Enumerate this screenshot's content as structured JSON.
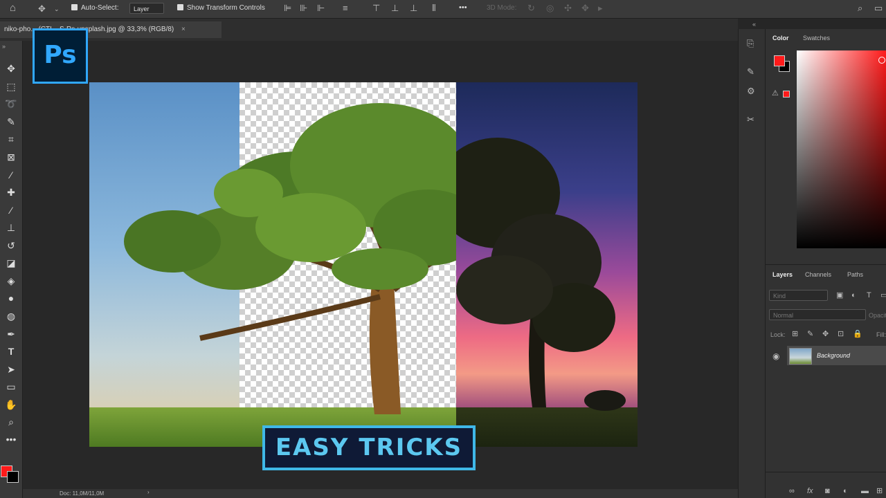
{
  "options_bar": {
    "auto_select_label": "Auto-Select:",
    "auto_select_value": "Layer",
    "show_transform_label": "Show Transform Controls",
    "mode_3d_label": "3D Mode:",
    "more_label": "•••"
  },
  "document": {
    "tab_title": "niko-pho... (CTL...S-Rs-unsplash.jpg @ 33,3% (RGB/8)",
    "close_glyph": "×",
    "status": "Doc: 11,0M/11,0M"
  },
  "logo": {
    "text": "Ps"
  },
  "banner": {
    "text": "EASY TRICKS"
  },
  "color_panel": {
    "tabs": [
      "Color",
      "Swatches"
    ],
    "foreground": "#ff1a1a",
    "background": "#000000"
  },
  "layers_panel": {
    "tabs": [
      "Layers",
      "Channels",
      "Paths"
    ],
    "kind_placeholder": "Kind",
    "blend_mode": "Normal",
    "opacity_label": "Opacity:",
    "lock_label": "Lock:",
    "fill_label": "Fill:",
    "layers": [
      {
        "name": "Background",
        "visible": true
      }
    ]
  },
  "colors": {
    "accent": "#31a8ff",
    "banner_text": "#5cc8f0",
    "banner_border": "#3fb8e8"
  }
}
